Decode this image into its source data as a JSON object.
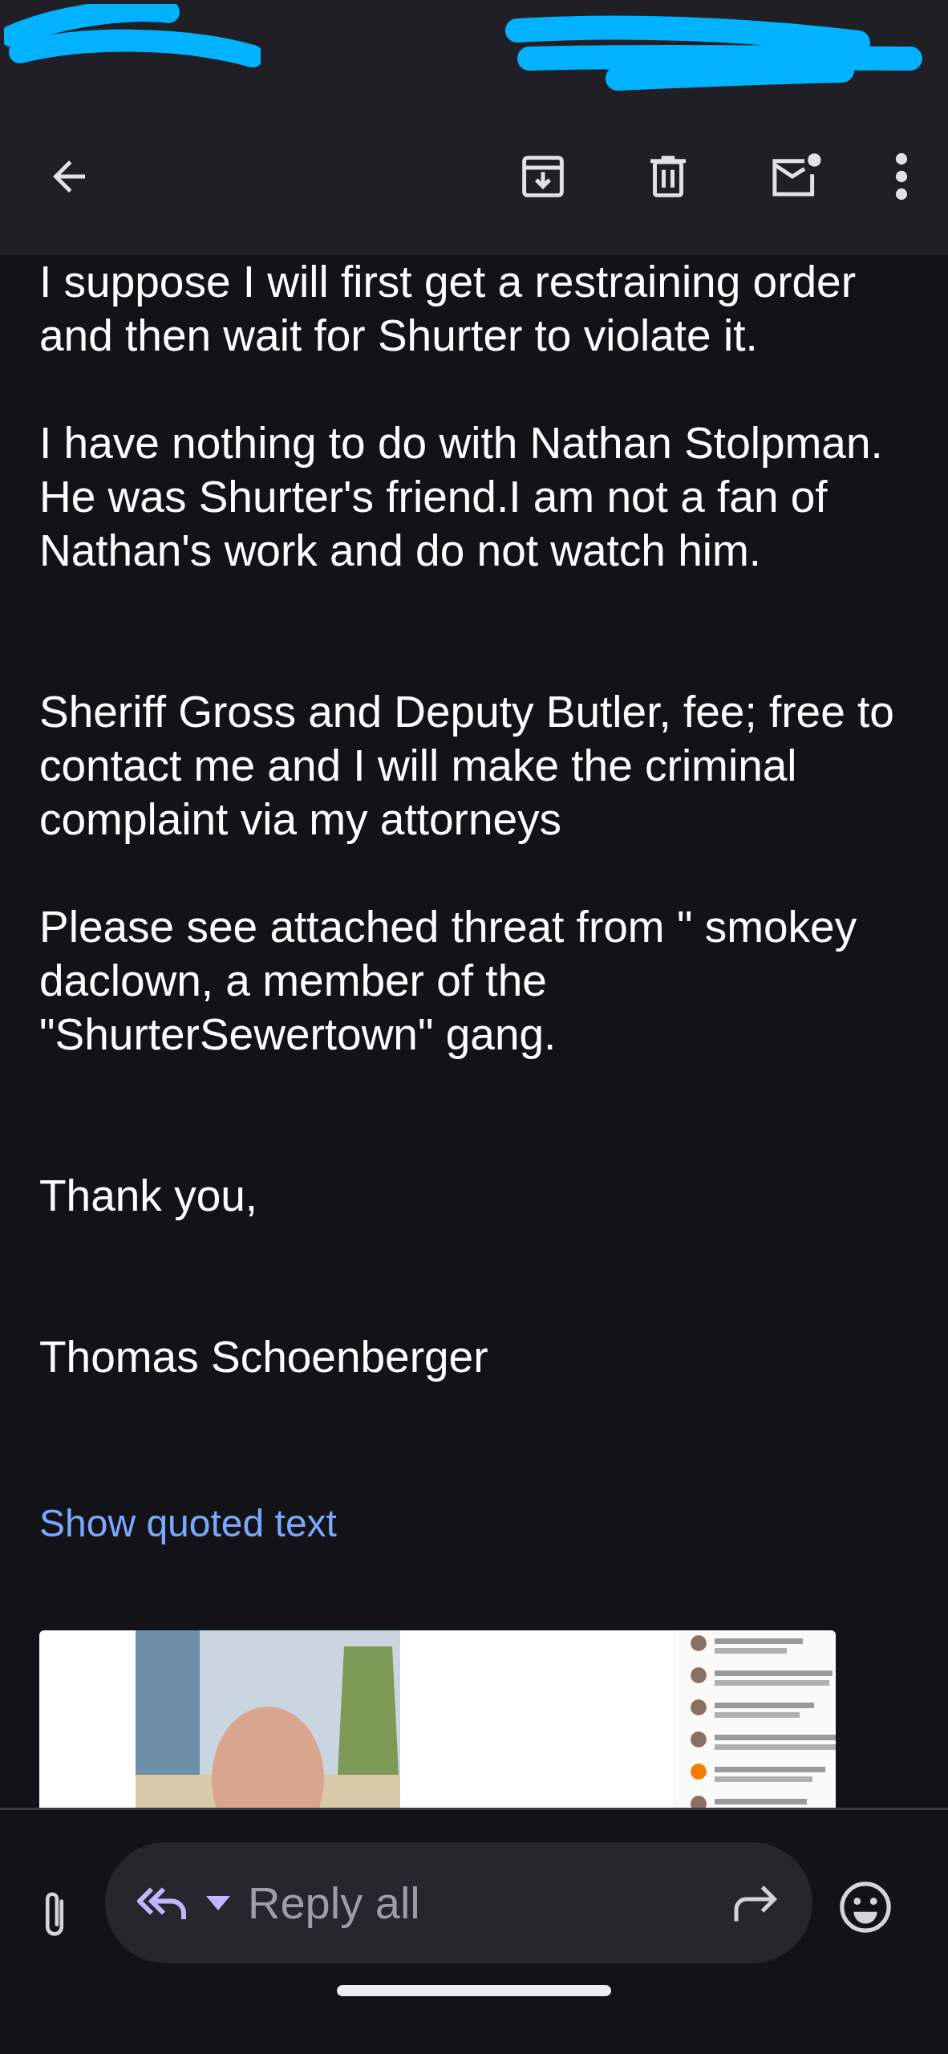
{
  "message": {
    "paragraphs": [
      {
        "lines": [
          "I suppose I will first get a restraining order",
          "and then wait for Shurter to violate it."
        ]
      },
      {
        "lines": [
          "I have nothing to do with Nathan Stolpman.",
          "He was Shurter's friend.I am not a fan of",
          "Nathan's work and do not watch him."
        ]
      },
      {
        "lines": [
          "Sheriff Gross and Deputy Butler, fee; free to",
          "contact me and I will make the criminal",
          "complaint via my attorneys"
        ]
      },
      {
        "lines": [
          "Please see attached threat from \" smokey",
          "daclown, a member of the",
          "\"ShurterSewertown\" gang."
        ]
      },
      {
        "lines": [
          "Thank you,"
        ]
      },
      {
        "lines": [
          "Thomas Schoenberger"
        ]
      }
    ],
    "quoted_link": "Show quoted text"
  },
  "reply_bar": {
    "placeholder": "Reply all"
  }
}
